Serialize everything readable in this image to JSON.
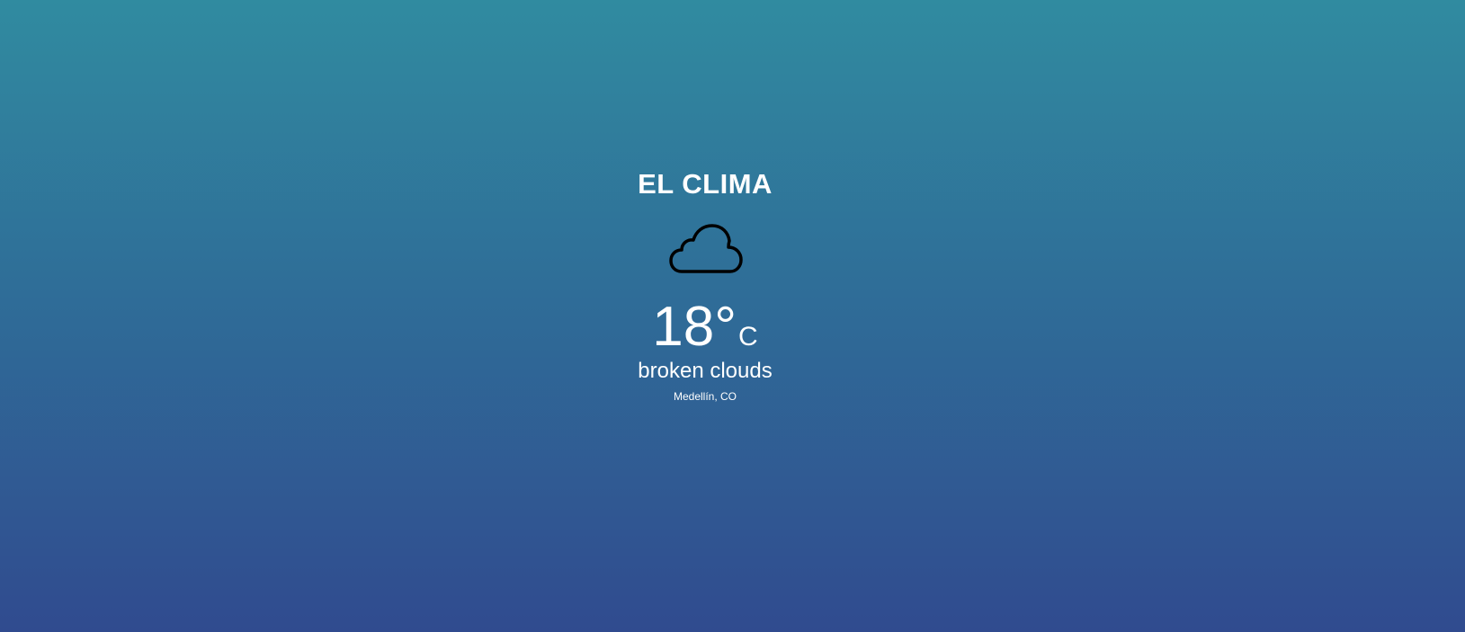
{
  "app": {
    "title": "EL CLIMA"
  },
  "weather": {
    "icon": "cloud-icon",
    "temperature": "18",
    "degree_symbol": "°",
    "unit": "C",
    "description": "broken clouds",
    "location": "Medellín, CO"
  },
  "colors": {
    "gradient_top": "#308ba0",
    "gradient_bottom": "#304b8f",
    "text": "#ffffff",
    "icon_stroke": "#000000"
  }
}
